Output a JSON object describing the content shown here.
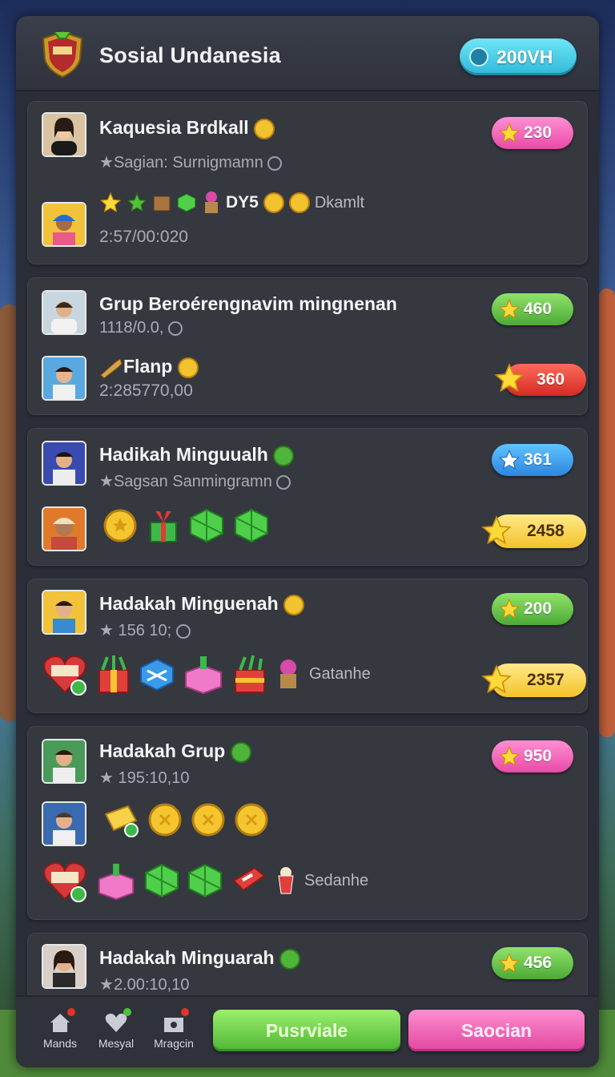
{
  "header": {
    "title": "Sosial Undanesia",
    "currency": "200VH"
  },
  "cards": [
    {
      "name": "Kaquesia Brdkall",
      "sub": "Sagian: Surnigmamn",
      "items_text": "DY5",
      "note": "Dkamlt",
      "time": "2:57/00:020",
      "pill1": "230",
      "pill1_color": "#e94aa8"
    },
    {
      "name": "Grup Beroérengnavim mingnenan",
      "sub": "1118/0.0,",
      "item_label": "Flanp",
      "time": "2:285770,00",
      "pill1": "460",
      "pill1_color": "#4caa36",
      "pill2": "360",
      "pill2_color": "#d42b24"
    },
    {
      "name": "Hadikah Minguualh",
      "sub": "Sagsan Sanmingramn",
      "pill1": "361",
      "pill1_color": "#2d86e0",
      "pill2": "2458",
      "pill2_color": "#f3c22a"
    },
    {
      "name": "Hadakah Minguenah",
      "sub": "156 10;",
      "note": "Gatanhe",
      "pill1": "200",
      "pill1_color": "#4caa36",
      "pill2": "2357",
      "pill2_color": "#f3c22a"
    },
    {
      "name": "Hadakah Grup",
      "sub": "195:10,10",
      "note": "Sedanhe",
      "pill1": "950",
      "pill1_color": "#e94aa8"
    },
    {
      "name": "Hadakah Minguarah",
      "sub": "2.00:10,10",
      "pill1": "456",
      "pill1_color": "#4caa36"
    }
  ],
  "bottom_nav": [
    {
      "label": "Mands",
      "icon": "home-icon"
    },
    {
      "label": "Mesyal",
      "icon": "heart-icon"
    },
    {
      "label": "Mragcin",
      "icon": "gift-box-icon"
    }
  ],
  "buttons": {
    "primary": "Pusrviale",
    "secondary": "Saocian"
  }
}
